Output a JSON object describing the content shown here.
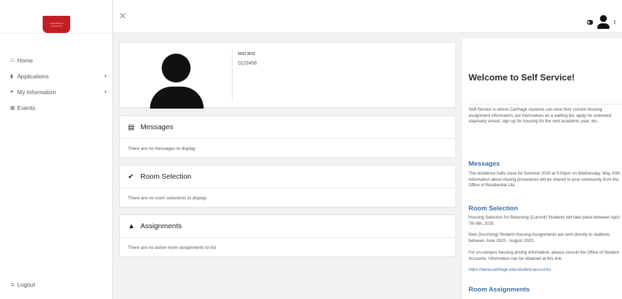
{
  "logo": {
    "line1": "CARTHAGE",
    "line2": "COLLEGE"
  },
  "sidebar": {
    "items": [
      {
        "label": "Home",
        "icon": "home-icon",
        "has_submenu": false
      },
      {
        "label": "Applications",
        "icon": "file-icon",
        "has_submenu": true
      },
      {
        "label": "My Information",
        "icon": "user-icon",
        "has_submenu": true
      },
      {
        "label": "Events",
        "icon": "calendar-icon",
        "has_submenu": false
      }
    ],
    "logout_label": "Logout"
  },
  "topbar": {
    "close_glyph": "×",
    "user_initial": "t"
  },
  "profile": {
    "name": "test test",
    "id": "0123456"
  },
  "sections": {
    "messages": {
      "title": "Messages",
      "body": "There are no messages to display"
    },
    "room_selection": {
      "title": "Room Selection",
      "body": "There are no room selections to display"
    },
    "assignments": {
      "title": "Assignments",
      "body": "There are no active room assignments to list"
    }
  },
  "welcome": {
    "title": "Welcome to Self Service!",
    "intro": "Self-Service is where Carthage students can view their current housing assignment information, put themselves on a waiting list, apply for extended stay/early arrival, sign up for housing for the next academic year, etc.",
    "messages_heading": "Messages",
    "messages_text": "The residence halls close for Summer 2020 at 5:00pm on Wednesday, May 20th. Information about closing procedures will be shared to your community from the Office of Residential Life.",
    "room_selection_heading": "Room Selection",
    "room_selection_p1": "Housing Selection for Returning (Current) Students will take place between April 7th-9th, 2020.",
    "room_selection_p2": "New (Incoming) Student Housing Assignments are sent directly to students between June 2020 - August 2020.",
    "room_selection_p3": "For on-campus housing pricing information, please consult the Office of Student Accounts. Information can be obtained at this link:",
    "room_selection_link": "https://www.carthage.edu/student-accounts/",
    "room_assignments_heading": "Room Assignments"
  },
  "colors": {
    "brand": "#c41e24",
    "link": "#3b6ea8"
  }
}
